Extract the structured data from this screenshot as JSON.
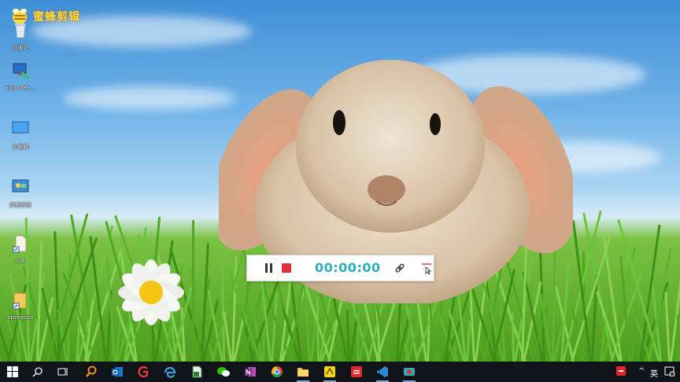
{
  "desktop": {
    "logo": {
      "text": "蜜蜂剪辑"
    },
    "icons": [
      {
        "label": "回收站",
        "icon": "recycle-bin-icon"
      },
      {
        "label": "xpub-Tea...",
        "icon": "network-computer-icon"
      },
      {
        "label": "此电脑",
        "icon": "computer-icon"
      },
      {
        "label": "控制面板",
        "icon": "control-panel-icon"
      },
      {
        "label": "cut",
        "icon": "document-shortcut-icon"
      },
      {
        "label": "operation",
        "icon": "folder-icon"
      }
    ]
  },
  "recorder": {
    "timer": "00:00:00",
    "controls": [
      "pause-icon",
      "stop-icon",
      "link-icon",
      "collapse-icon"
    ],
    "colors": {
      "timer": "#2bb0b7",
      "stop": "#e0323c"
    }
  },
  "taskbar": {
    "items": [
      {
        "name": "start-button",
        "icon": "windows-logo-icon"
      },
      {
        "name": "search-button",
        "icon": "search-icon"
      },
      {
        "name": "task-view-button",
        "icon": "task-view-icon"
      },
      {
        "name": "taskbar-search-app",
        "icon": "magnifier-app-icon"
      },
      {
        "name": "taskbar-outlook",
        "icon": "outlook-icon"
      },
      {
        "name": "taskbar-app-g",
        "icon": "red-g-icon"
      },
      {
        "name": "taskbar-edge",
        "icon": "edge-icon"
      },
      {
        "name": "taskbar-excel-file",
        "icon": "spreadsheet-icon"
      },
      {
        "name": "taskbar-wechat",
        "icon": "wechat-icon"
      },
      {
        "name": "taskbar-onenote",
        "icon": "onenote-icon"
      },
      {
        "name": "taskbar-chrome",
        "icon": "chrome-icon"
      },
      {
        "name": "taskbar-file-explorer",
        "icon": "folder-icon"
      },
      {
        "name": "taskbar-app-yellow",
        "icon": "yellow-app-icon"
      },
      {
        "name": "taskbar-app-red",
        "icon": "red-app-icon"
      },
      {
        "name": "taskbar-vscode",
        "icon": "vscode-icon"
      },
      {
        "name": "taskbar-recorder",
        "icon": "recorder-icon"
      }
    ],
    "tray": {
      "chevron": "^",
      "ime": "英"
    }
  }
}
